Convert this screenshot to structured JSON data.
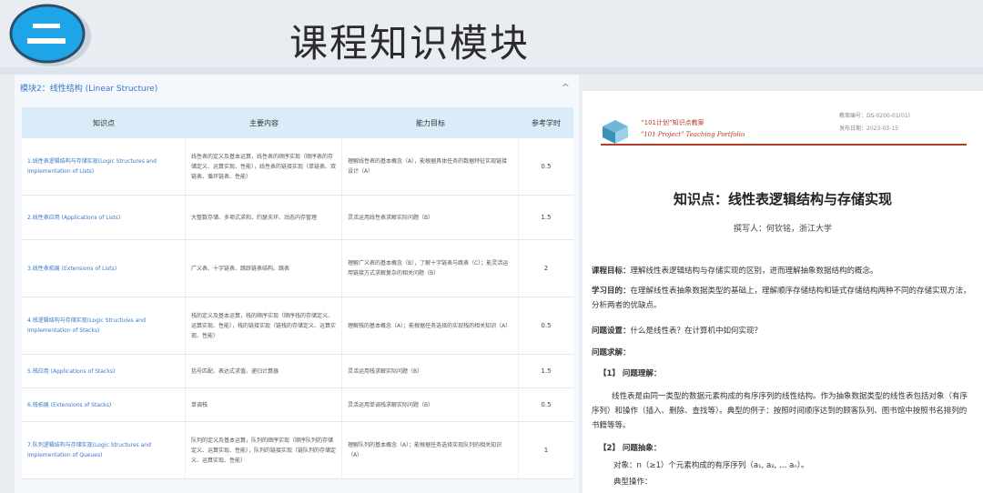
{
  "header": {
    "badge_text": "二",
    "title": "课程知识模块"
  },
  "module": {
    "title": "模块2：线性结构 (Linear Structure)",
    "caret": "^"
  },
  "table": {
    "headers": [
      "知识点",
      "主要内容",
      "能力目标",
      "参考学时"
    ],
    "rows": [
      {
        "point": "1.线性表逻辑结构与存储实现(Logic Structures and Implementation of Lists)",
        "content": "线性表的定义及基本运算，线性表的顺序实现（顺序表的存储定义、运算实现、性能），线性表的链接实现（单链表、双链表、循环链表、性能）",
        "goal": "理解线性表的基本概念（A），能根据具体任务的数据特征实现链接设计（A）",
        "hours": "0.5"
      },
      {
        "point": "2.线性表应用 (Applications of Lists)",
        "content": "大整数存储、多项式求和、约瑟夫环、动态内存管理",
        "goal": "灵活运用线性表求解实际问题（B）",
        "hours": "1.5"
      },
      {
        "point": "3.线性表拓展 (Extensions of Lists)",
        "content": "广义表、十字链表、跳跃链表结构、跳表",
        "goal": "理解广义表的基本概念（B），了解十字链表与跳表（C）；能灵活运用链接方式求解复杂的相关问题（B）",
        "hours": "2"
      },
      {
        "point": "4.栈逻辑结构与存储实现(Logic Structures and Implementation of Stacks)",
        "content": "栈的定义及基本运算，栈的顺序实现（顺序栈的存储定义、运算实现、性能），栈的链接实现（链栈的存储定义、运算实现、性能）",
        "goal": "理解栈的基本概念（A）；能根据任务选择的实现栈的相关知识（A）",
        "hours": "0.5"
      },
      {
        "point": "5.栈应用 (Applications of Stacks)",
        "content": "括号匹配、表达式求值、递归计算器",
        "goal": "灵活运用栈求解实际问题（B）",
        "hours": "1.5"
      },
      {
        "point": "6.栈拓展 (Extensions of Stacks)",
        "content": "单调栈",
        "goal": "灵活运用单调栈求解实际问题（B）",
        "hours": "0.5"
      },
      {
        "point": "7.队列逻辑结构与存储实现(Logic Structures and Implementation of Queues)",
        "content": "队列的定义及基本运算，队列的顺序实现（顺序队列的存储定义、运算实现、性能），队列的链接实现（链队列的存储定义、运算实现、性能）",
        "goal": "理解队列的基本概念（A）；能根据任务选择实现队列的相关知识（A）",
        "hours": "1"
      }
    ]
  },
  "doc": {
    "org_cn": "“101计划”知识点教案",
    "org_en": "\"101 Project\" Teaching Portfolio",
    "meta1": "教案编号：",
    "meta1_val": "DS-0200-01(01)",
    "meta2": "发布日期：",
    "meta2_val": "2023-03-15",
    "title": "知识点：线性表逻辑结构与存储实现",
    "author": "撰写人：何钦铭，浙江大学",
    "p1_label": "课程目标：",
    "p1_text": "理解线性表逻辑结构与存储实现的区别，进而理解抽象数据结构的概念。",
    "p2_label": "学习目的：",
    "p2_text": "在理解线性表抽象数据类型的基础上，理解顺序存储结构和链式存储结构两种不同的存储实现方法，分析两者的优缺点。",
    "p3_label": "问题设置：",
    "p3_text": "什么是线性表？在计算机中如何实现？",
    "p4": "问题求解：",
    "s1": "【1】  问题理解：",
    "p5": "线性表是由同一类型的数据元素构成的有序序列的线性结构。作为抽象数据类型的线性表包括对象（有序序列）和操作（插入、删除、查找等）。典型的例子：按照时间顺序达到的顾客队列、图书馆中按照书名排列的书籍等等。",
    "s2": "【2】  问题抽象：",
    "p6": "对象：n（≥1）个元素构成的有序序列（a₁, a₂, … aₙ）。",
    "p7": "典型操作："
  }
}
